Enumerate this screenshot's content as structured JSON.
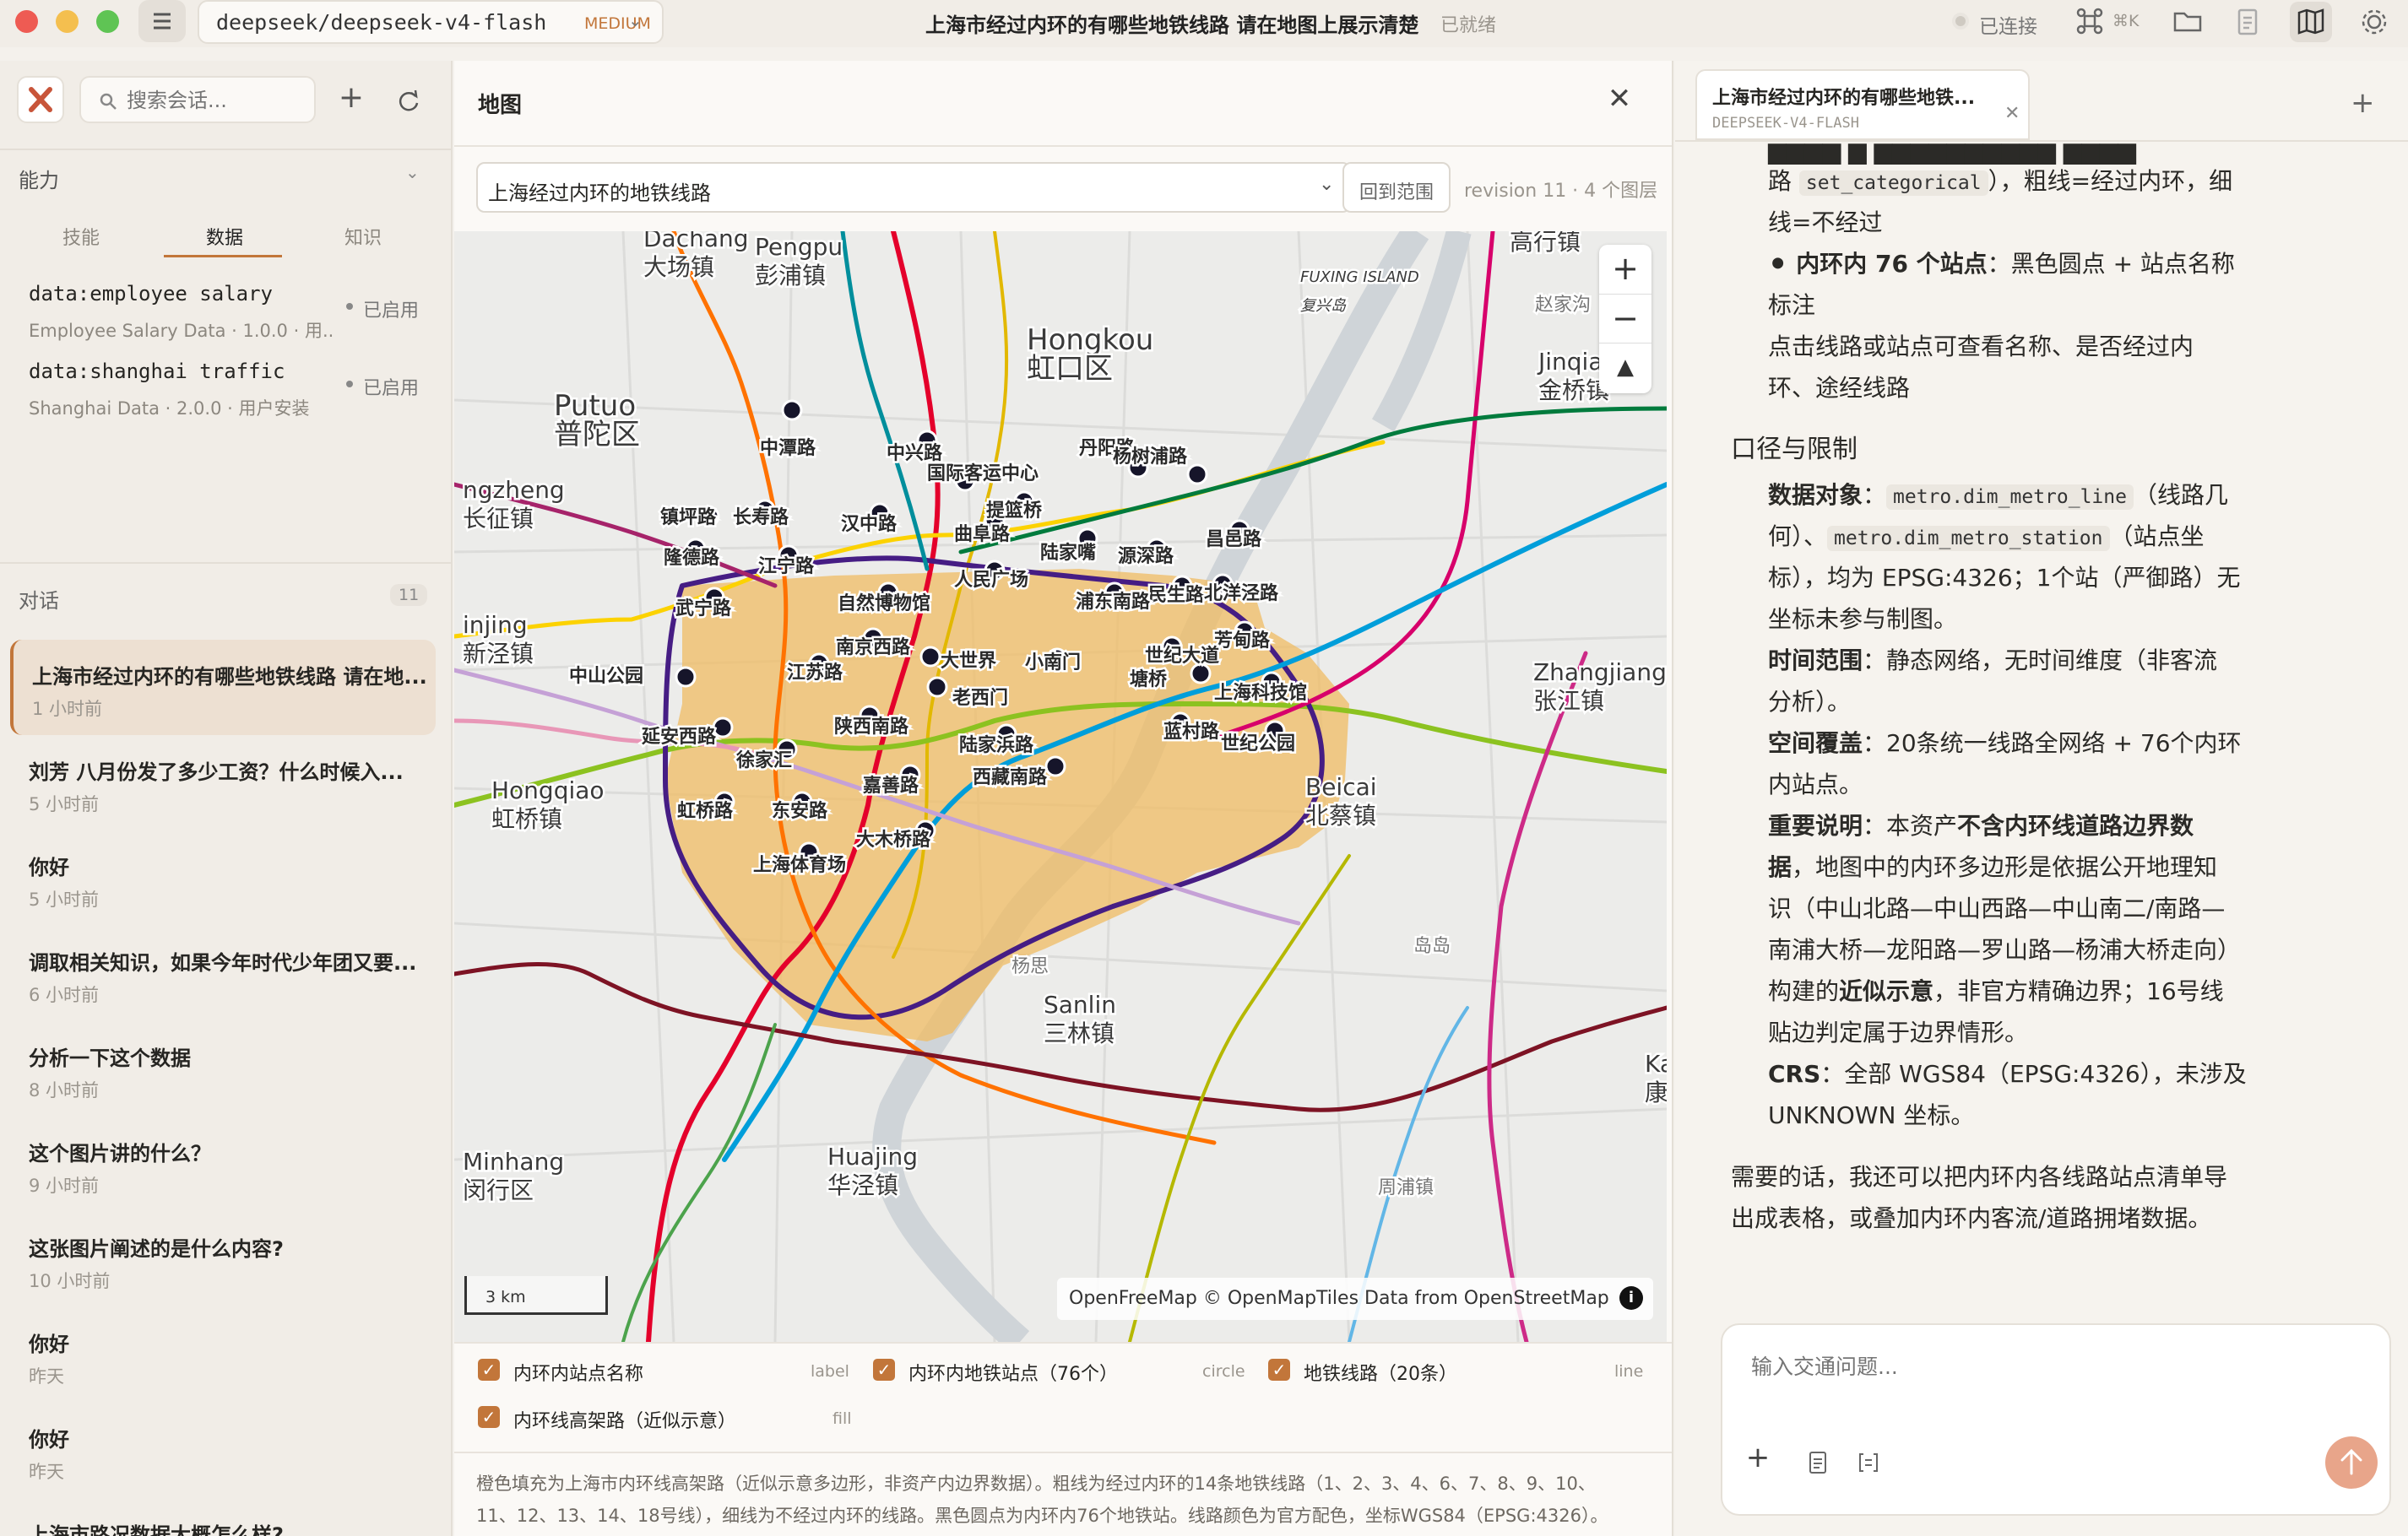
{
  "titlebar": {
    "model": "deepseek/deepseek-v4-flash",
    "model_tier": "MEDIUM",
    "title": "上海市经过内环的有哪些地铁线路 请在地图上展示清楚",
    "status": "已就绪",
    "connection": "已连接",
    "shortcut": "⌘K"
  },
  "sidebar": {
    "search_placeholder": "搜索会话...",
    "capabilities_label": "能力",
    "tabs": [
      "技能",
      "数据",
      "知识"
    ],
    "data_items": [
      {
        "title": "data:employee salary",
        "subtitle": "Employee Salary Data · 1.0.0 · 用...",
        "status": "已启用"
      },
      {
        "title": "data:shanghai traffic",
        "subtitle": "Shanghai Data · 2.0.0 · 用户安装",
        "status": "已启用"
      }
    ],
    "conversations_label": "对话",
    "conversations_count": "11",
    "conversations": [
      {
        "title": "上海市经过内环的有哪些地铁线路 请在地...",
        "time": "1 小时前"
      },
      {
        "title": "刘芳 八月份发了多少工资？什么时候入...",
        "time": "5 小时前"
      },
      {
        "title": "你好",
        "time": "5 小时前"
      },
      {
        "title": "调取相关知识，如果今年时代少年团又要...",
        "time": "6 小时前"
      },
      {
        "title": "分析一下这个数据",
        "time": "8 小时前"
      },
      {
        "title": "这个图片讲的什么？",
        "time": "9 小时前"
      },
      {
        "title": "这张图片阐述的是什么内容?",
        "time": "10 小时前"
      },
      {
        "title": "你好",
        "time": "昨天"
      },
      {
        "title": "你好",
        "time": "昨天"
      },
      {
        "title": "上海市路况数据大概怎么样?",
        "time": ""
      }
    ]
  },
  "map_panel": {
    "title": "地图",
    "layer_select": "上海经过内环的地铁线路",
    "reset_button": "回到范围",
    "revision": "revision 11 · 4 个图层",
    "scale": "3 km",
    "attribution": "OpenFreeMap © OpenMapTiles Data from OpenStreetMap",
    "layers": [
      {
        "name": "内环内站点名称",
        "type": "label"
      },
      {
        "name": "内环内地铁站点（76个）",
        "type": "circle"
      },
      {
        "name": "地铁线路（20条）",
        "type": "line"
      },
      {
        "name": "内环线高架路（近似示意）",
        "type": "fill"
      }
    ],
    "caption_1": "橙色填充为上海市内环线高架路（近似示意多边形，非资产内边界数据）。粗线为经过内环的14条地铁线路（1、2、3、4、6、7、8、9、10、",
    "caption_2": "11、12、13、14、18号线），细线为不经过内环的线路。黑色圆点为内环内76个地铁站。线路颜色为官方配色，坐标WGS84（EPSG:4326）。",
    "place_names": [
      {
        "en": "Dachang",
        "zh": "大场镇"
      },
      {
        "en": "Pengpu",
        "zh": "彭浦镇"
      },
      {
        "en": "Hongkou",
        "zh": "虹口区"
      },
      {
        "en": "Putuo",
        "zh": "普陀区"
      },
      {
        "en": "Gaohang",
        "zh": "高行镇"
      },
      {
        "en": "Jinqiao",
        "zh": "金桥镇"
      },
      {
        "en": "Zhangjiang",
        "zh": "张江镇"
      },
      {
        "en": "Hongqiao",
        "zh": "虹桥镇"
      },
      {
        "en": "Beicai",
        "zh": "北蔡镇"
      },
      {
        "en": "Sanlin",
        "zh": "三林镇"
      },
      {
        "en": "Huajing",
        "zh": "华泾镇"
      },
      {
        "en": "FUXING ISLAND",
        "zh": "复兴岛"
      },
      {
        "en": "ngzheng",
        "zh": "长征镇"
      },
      {
        "en": "injing",
        "zh": "新泾镇"
      },
      {
        "en": "Minhang",
        "zh": "闵行区"
      },
      {
        "en": "Kar",
        "zh": "康"
      },
      {
        "en": "",
        "zh": "赵家沟"
      },
      {
        "en": "",
        "zh": "周浦镇"
      },
      {
        "en": "",
        "zh": "杨思"
      },
      {
        "en": "",
        "zh": "岛岛"
      }
    ],
    "stations": [
      "中潭路",
      "中兴路",
      "国际客运中心",
      "丹阳路",
      "杨树浦路",
      "提篮桥",
      "镇坪路",
      "长寿路",
      "汉中路",
      "曲阜路",
      "陆家嘴",
      "源深路",
      "昌邑路",
      "隆德路",
      "江宁路",
      "民生路",
      "北洋泾路",
      "人民广场",
      "浦东南路",
      "武宁路",
      "自然博物馆",
      "芳甸路",
      "南京西路",
      "大世界",
      "小南门",
      "世纪大道",
      "中山公园",
      "江苏路",
      "老西门",
      "塘桥",
      "上海科技馆",
      "陕西南路",
      "延安西路",
      "陆家浜路",
      "蓝村路",
      "世纪公园",
      "徐家汇",
      "西藏南路",
      "嘉善路",
      "虹桥路",
      "东安路",
      "大木桥路",
      "上海体育场"
    ]
  },
  "chat": {
    "tab_title": "上海市经过内环的有哪些地铁...",
    "tab_model": "DEEPSEEK-V4-FLASH",
    "lines": [
      "路 set_categorical），粗线=经过内环，细",
      "线=不经过",
      "内环内 76 个站点：黑色圆点 + 站点名称",
      "标注",
      "点击线路或站点可查看名称、是否经过内",
      "环、途经线路",
      "口径与限制",
      "数据对象：metro.dim_metro_line（线路几",
      "何）、metro.dim_metro_station（站点坐",
      "标），均为 EPSG:4326；1个站（严御路）无",
      "坐标未参与制图。",
      "时间范围：静态网络，无时间维度（非客流",
      "分析）。",
      "空间覆盖：20条统一线路全网络 + 76个内环",
      "内站点。",
      "重要说明：本资产不含内环线道路边界数",
      "据，地图中的内环多边形是依据公开地理知",
      "识（中山北路—中山西路—中山南二/南路—",
      "南浦大桥—龙阳路—罗山路—杨浦大桥走向）",
      "构建的近似示意，非官方精确边界；16号线",
      "贴边判定属于边界情形。",
      "CRS：全部 WGS84（EPSG:4326），未涉及",
      "UNKNOWN 坐标。",
      "需要的话，我还可以把内环内各线路站点清单导",
      "出成表格，或叠加内环内客流/道路拥堵数据。"
    ],
    "input_placeholder": "输入交通问题..."
  },
  "colors": {
    "accent": "#c2763a",
    "ring_fill": "#f0bc63",
    "selected": "#ede0d2"
  }
}
